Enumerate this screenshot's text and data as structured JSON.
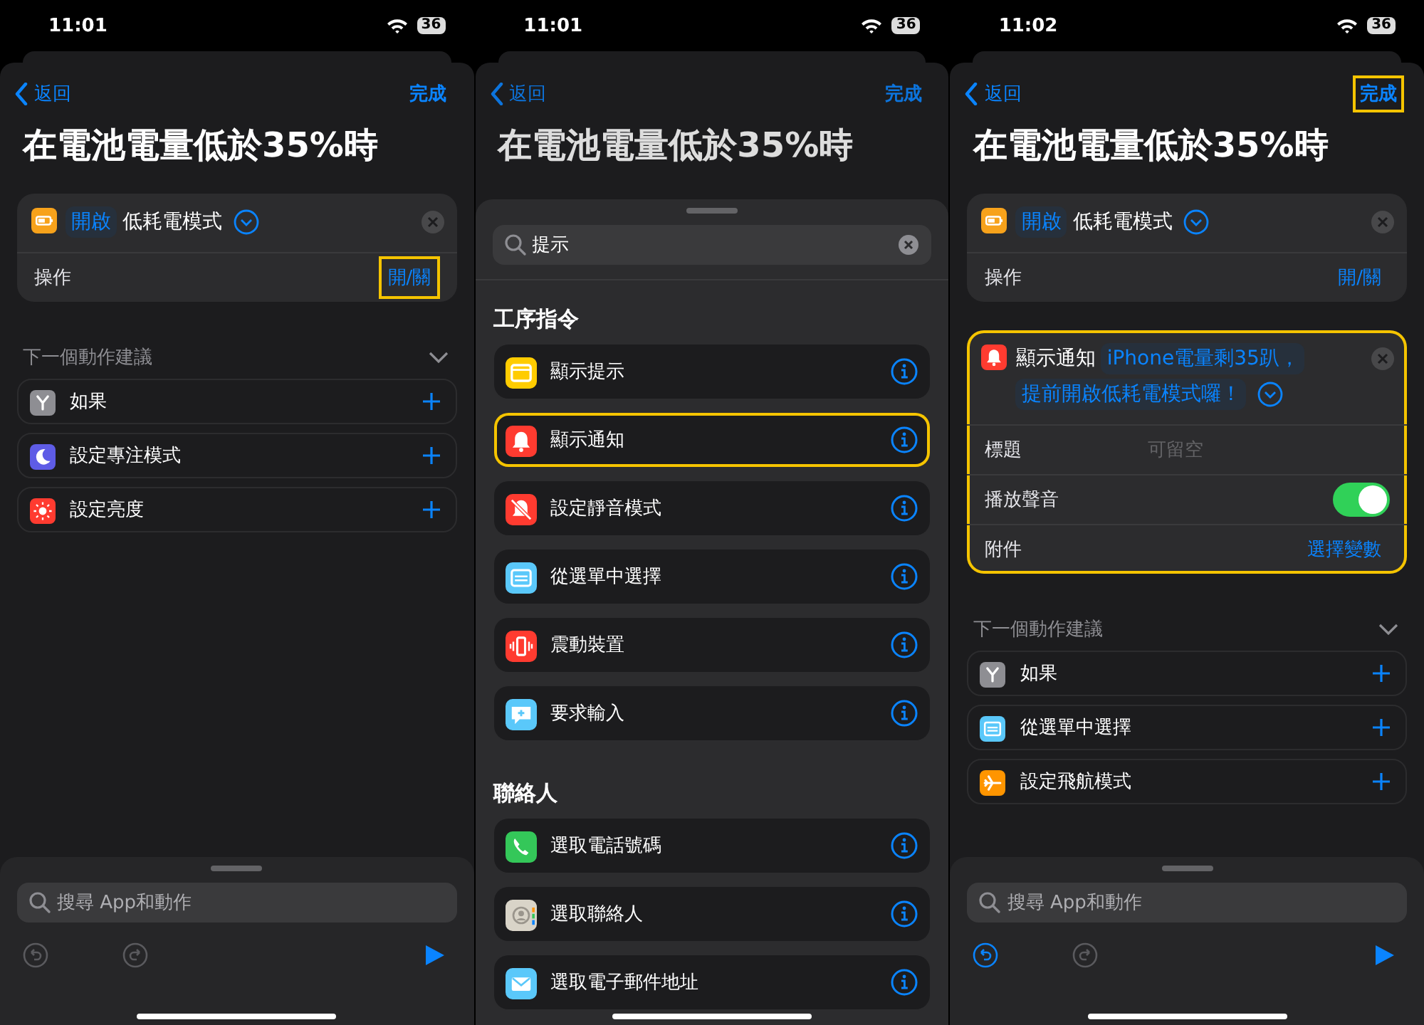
{
  "phones": [
    {
      "kind": "editor",
      "status": {
        "time": "11:01",
        "battery": "36"
      },
      "nav": {
        "back": "返回",
        "done": "完成",
        "done_highlighted": false
      },
      "title": "在電池電量低於35%時",
      "actions": [
        {
          "kind": "battery",
          "color": "#f7a21b",
          "highlighted": false,
          "parts": [
            {
              "kind": "token",
              "text": "開啟"
            },
            {
              "kind": "text",
              "text": "低耗電模式"
            }
          ],
          "params": [
            {
              "kind": "link",
              "label": "操作",
              "value": "開/關",
              "highlighted": true
            }
          ]
        }
      ],
      "suggestions": {
        "heading": "下一個動作建議",
        "items": [
          {
            "kind": "branch",
            "color": "#8e8e93",
            "label": "如果"
          },
          {
            "kind": "moon",
            "color": "#5e5ce6",
            "label": "設定專注模式"
          },
          {
            "kind": "sun",
            "color": "#ff3b30",
            "label": "設定亮度"
          }
        ]
      },
      "search": {
        "placeholder": "搜尋 App和動作"
      },
      "toolbar": {
        "undo_enabled": false
      }
    },
    {
      "kind": "search",
      "status": {
        "time": "11:01",
        "battery": "36"
      },
      "nav": {
        "back": "返回",
        "done": "完成",
        "done_highlighted": false
      },
      "title": "在電池電量低於35%時",
      "query": "提示",
      "sections": [
        {
          "title": "工序指令",
          "items": [
            {
              "kind": "window",
              "color": "#ffcc00",
              "label": "顯示提示",
              "highlighted": false
            },
            {
              "kind": "bell",
              "color": "#ff3b30",
              "label": "顯示通知",
              "highlighted": true
            },
            {
              "kind": "mute",
              "color": "#ff3b30",
              "label": "設定靜音模式",
              "highlighted": false
            },
            {
              "kind": "list",
              "color": "#5ac8fa",
              "label": "從選單中選擇",
              "highlighted": false
            },
            {
              "kind": "vibrate",
              "color": "#ff3b30",
              "label": "震動裝置",
              "highlighted": false
            },
            {
              "kind": "bubble",
              "color": "#5ac8fa",
              "label": "要求輸入",
              "highlighted": false
            }
          ]
        },
        {
          "title": "聯絡人",
          "items": [
            {
              "kind": "phone",
              "color": "#34c759",
              "label": "選取電話號碼",
              "highlighted": false
            },
            {
              "kind": "contact",
              "color": "#d9d4c8",
              "label": "選取聯絡人",
              "highlighted": false
            },
            {
              "kind": "mail",
              "color": "#5ac8fa",
              "label": "選取電子郵件地址",
              "highlighted": false
            }
          ]
        }
      ]
    },
    {
      "kind": "editor",
      "status": {
        "time": "11:02",
        "battery": "36"
      },
      "nav": {
        "back": "返回",
        "done": "完成",
        "done_highlighted": true
      },
      "title": "在電池電量低於35%時",
      "actions": [
        {
          "kind": "battery",
          "color": "#f7a21b",
          "highlighted": false,
          "parts": [
            {
              "kind": "token",
              "text": "開啟"
            },
            {
              "kind": "text",
              "text": "低耗電模式"
            }
          ],
          "params": [
            {
              "kind": "link",
              "label": "操作",
              "value": "開/關",
              "highlighted": false
            }
          ]
        },
        {
          "kind": "bell",
          "color": "#ff3b30",
          "highlighted": true,
          "parts": [
            {
              "kind": "text",
              "text": "顯示通知"
            },
            {
              "kind": "token",
              "text": "iPhone電量剩35趴，"
            },
            {
              "kind": "token",
              "text": "提前開啟低耗電模式囉！"
            }
          ],
          "params": [
            {
              "kind": "field",
              "label": "標題",
              "placeholder": "可留空"
            },
            {
              "kind": "toggle",
              "label": "播放聲音",
              "on": true
            },
            {
              "kind": "link",
              "label": "附件",
              "value": "選擇變數",
              "highlighted": false
            }
          ]
        }
      ],
      "suggestions": {
        "heading": "下一個動作建議",
        "items": [
          {
            "kind": "branch",
            "color": "#8e8e93",
            "label": "如果"
          },
          {
            "kind": "list",
            "color": "#5ac8fa",
            "label": "從選單中選擇"
          },
          {
            "kind": "airplane",
            "color": "#ff9500",
            "label": "設定飛航模式"
          }
        ]
      },
      "search": {
        "placeholder": "搜尋 App和動作"
      },
      "toolbar": {
        "undo_enabled": true
      }
    }
  ]
}
